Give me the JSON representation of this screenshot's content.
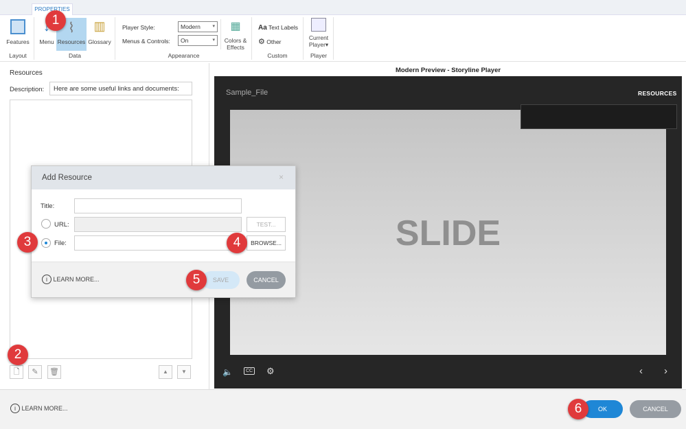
{
  "ribbon": {
    "tab": "PROPERTIES",
    "buttons": {
      "features": "Features",
      "menu": "Menu",
      "resources": "Resources",
      "glossary": "Glossary",
      "colors": "Colors & Effects",
      "text_labels": "Text Labels",
      "other": "Other",
      "current_player": "Current Player"
    },
    "player_style_label": "Player Style:",
    "player_style_value": "Modern",
    "menus_controls_label": "Menus & Controls:",
    "menus_controls_value": "On",
    "groups": {
      "layout": "Layout",
      "data": "Data",
      "appearance": "Appearance",
      "custom": "Custom",
      "player": "Player"
    }
  },
  "left": {
    "heading": "Resources",
    "description_label": "Description:",
    "description_value": "Here are some useful links and documents:"
  },
  "dialog": {
    "title": "Add Resource",
    "title_label": "Title:",
    "title_value": "",
    "url_label": "URL:",
    "url_value": "",
    "file_label": "File:",
    "file_value": "",
    "test": "TEST...",
    "browse": "BROWSE...",
    "learn_more": "LEARN MORE...",
    "save": "SAVE",
    "cancel": "CANCEL",
    "selected_source": "File"
  },
  "preview": {
    "title": "Modern Preview - Storyline Player",
    "file_name": "Sample_File",
    "resources_tab": "RESOURCES",
    "slide_text": "SLIDE"
  },
  "footer": {
    "learn_more": "LEARN MORE...",
    "ok": "OK",
    "cancel": "CANCEL"
  },
  "badges": [
    "1",
    "2",
    "3",
    "4",
    "5",
    "6"
  ],
  "colors": {
    "accent": "#2b79c2",
    "badge": "#e03a3c",
    "selected_ribbon": "#b3d7f0"
  }
}
